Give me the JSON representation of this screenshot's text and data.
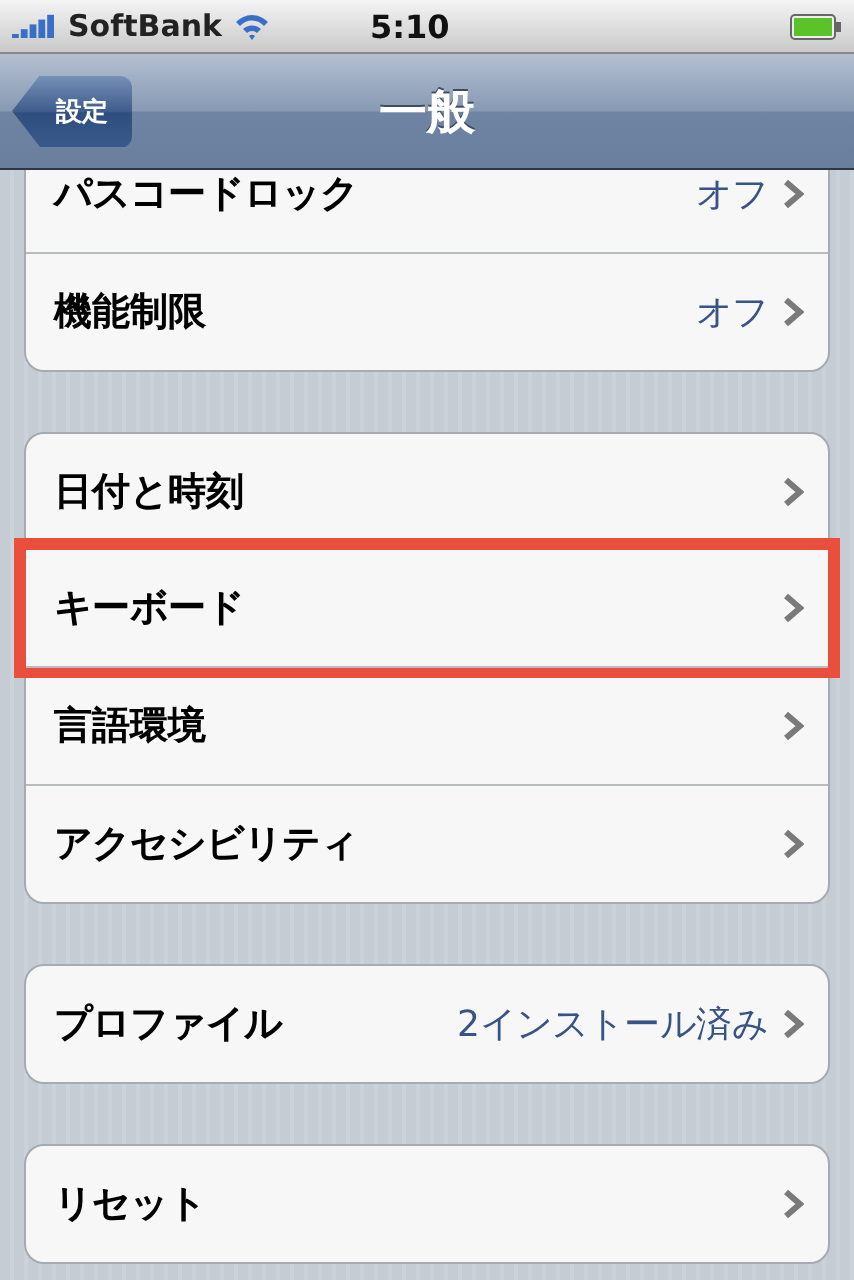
{
  "status_bar": {
    "carrier": "SoftBank",
    "time": "5:10"
  },
  "nav_bar": {
    "back_button": "設定",
    "title": "一般"
  },
  "groups": [
    {
      "rows": [
        {
          "label": "パスコードロック",
          "value": "オフ",
          "highlighted": false
        },
        {
          "label": "機能制限",
          "value": "オフ",
          "highlighted": false
        }
      ]
    },
    {
      "rows": [
        {
          "label": "日付と時刻",
          "highlighted": false
        },
        {
          "label": "キーボード",
          "highlighted": true
        },
        {
          "label": "言語環境",
          "highlighted": false
        },
        {
          "label": "アクセシビリティ",
          "highlighted": false
        }
      ]
    },
    {
      "rows": [
        {
          "label": "プロファイル",
          "value": "2インストール済み",
          "highlighted": false
        }
      ]
    },
    {
      "rows": [
        {
          "label": "リセット",
          "highlighted": false
        }
      ]
    }
  ]
}
